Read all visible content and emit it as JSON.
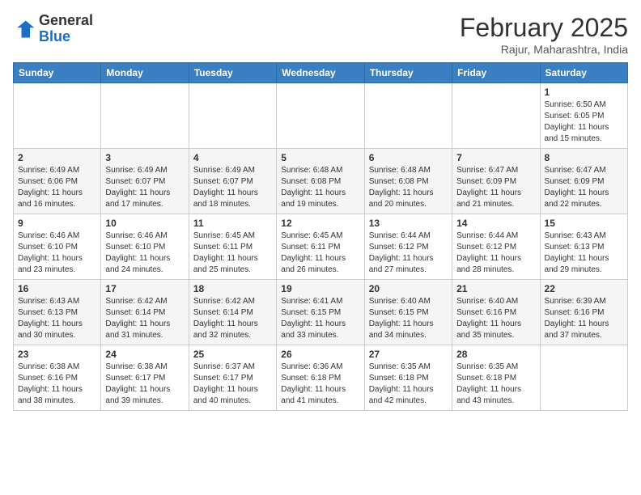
{
  "header": {
    "logo_general": "General",
    "logo_blue": "Blue",
    "month": "February 2025",
    "location": "Rajur, Maharashtra, India"
  },
  "weekdays": [
    "Sunday",
    "Monday",
    "Tuesday",
    "Wednesday",
    "Thursday",
    "Friday",
    "Saturday"
  ],
  "weeks": [
    [
      {
        "day": "",
        "info": ""
      },
      {
        "day": "",
        "info": ""
      },
      {
        "day": "",
        "info": ""
      },
      {
        "day": "",
        "info": ""
      },
      {
        "day": "",
        "info": ""
      },
      {
        "day": "",
        "info": ""
      },
      {
        "day": "1",
        "info": "Sunrise: 6:50 AM\nSunset: 6:05 PM\nDaylight: 11 hours\nand 15 minutes."
      }
    ],
    [
      {
        "day": "2",
        "info": "Sunrise: 6:49 AM\nSunset: 6:06 PM\nDaylight: 11 hours\nand 16 minutes."
      },
      {
        "day": "3",
        "info": "Sunrise: 6:49 AM\nSunset: 6:07 PM\nDaylight: 11 hours\nand 17 minutes."
      },
      {
        "day": "4",
        "info": "Sunrise: 6:49 AM\nSunset: 6:07 PM\nDaylight: 11 hours\nand 18 minutes."
      },
      {
        "day": "5",
        "info": "Sunrise: 6:48 AM\nSunset: 6:08 PM\nDaylight: 11 hours\nand 19 minutes."
      },
      {
        "day": "6",
        "info": "Sunrise: 6:48 AM\nSunset: 6:08 PM\nDaylight: 11 hours\nand 20 minutes."
      },
      {
        "day": "7",
        "info": "Sunrise: 6:47 AM\nSunset: 6:09 PM\nDaylight: 11 hours\nand 21 minutes."
      },
      {
        "day": "8",
        "info": "Sunrise: 6:47 AM\nSunset: 6:09 PM\nDaylight: 11 hours\nand 22 minutes."
      }
    ],
    [
      {
        "day": "9",
        "info": "Sunrise: 6:46 AM\nSunset: 6:10 PM\nDaylight: 11 hours\nand 23 minutes."
      },
      {
        "day": "10",
        "info": "Sunrise: 6:46 AM\nSunset: 6:10 PM\nDaylight: 11 hours\nand 24 minutes."
      },
      {
        "day": "11",
        "info": "Sunrise: 6:45 AM\nSunset: 6:11 PM\nDaylight: 11 hours\nand 25 minutes."
      },
      {
        "day": "12",
        "info": "Sunrise: 6:45 AM\nSunset: 6:11 PM\nDaylight: 11 hours\nand 26 minutes."
      },
      {
        "day": "13",
        "info": "Sunrise: 6:44 AM\nSunset: 6:12 PM\nDaylight: 11 hours\nand 27 minutes."
      },
      {
        "day": "14",
        "info": "Sunrise: 6:44 AM\nSunset: 6:12 PM\nDaylight: 11 hours\nand 28 minutes."
      },
      {
        "day": "15",
        "info": "Sunrise: 6:43 AM\nSunset: 6:13 PM\nDaylight: 11 hours\nand 29 minutes."
      }
    ],
    [
      {
        "day": "16",
        "info": "Sunrise: 6:43 AM\nSunset: 6:13 PM\nDaylight: 11 hours\nand 30 minutes."
      },
      {
        "day": "17",
        "info": "Sunrise: 6:42 AM\nSunset: 6:14 PM\nDaylight: 11 hours\nand 31 minutes."
      },
      {
        "day": "18",
        "info": "Sunrise: 6:42 AM\nSunset: 6:14 PM\nDaylight: 11 hours\nand 32 minutes."
      },
      {
        "day": "19",
        "info": "Sunrise: 6:41 AM\nSunset: 6:15 PM\nDaylight: 11 hours\nand 33 minutes."
      },
      {
        "day": "20",
        "info": "Sunrise: 6:40 AM\nSunset: 6:15 PM\nDaylight: 11 hours\nand 34 minutes."
      },
      {
        "day": "21",
        "info": "Sunrise: 6:40 AM\nSunset: 6:16 PM\nDaylight: 11 hours\nand 35 minutes."
      },
      {
        "day": "22",
        "info": "Sunrise: 6:39 AM\nSunset: 6:16 PM\nDaylight: 11 hours\nand 37 minutes."
      }
    ],
    [
      {
        "day": "23",
        "info": "Sunrise: 6:38 AM\nSunset: 6:16 PM\nDaylight: 11 hours\nand 38 minutes."
      },
      {
        "day": "24",
        "info": "Sunrise: 6:38 AM\nSunset: 6:17 PM\nDaylight: 11 hours\nand 39 minutes."
      },
      {
        "day": "25",
        "info": "Sunrise: 6:37 AM\nSunset: 6:17 PM\nDaylight: 11 hours\nand 40 minutes."
      },
      {
        "day": "26",
        "info": "Sunrise: 6:36 AM\nSunset: 6:18 PM\nDaylight: 11 hours\nand 41 minutes."
      },
      {
        "day": "27",
        "info": "Sunrise: 6:35 AM\nSunset: 6:18 PM\nDaylight: 11 hours\nand 42 minutes."
      },
      {
        "day": "28",
        "info": "Sunrise: 6:35 AM\nSunset: 6:18 PM\nDaylight: 11 hours\nand 43 minutes."
      },
      {
        "day": "",
        "info": ""
      }
    ]
  ]
}
